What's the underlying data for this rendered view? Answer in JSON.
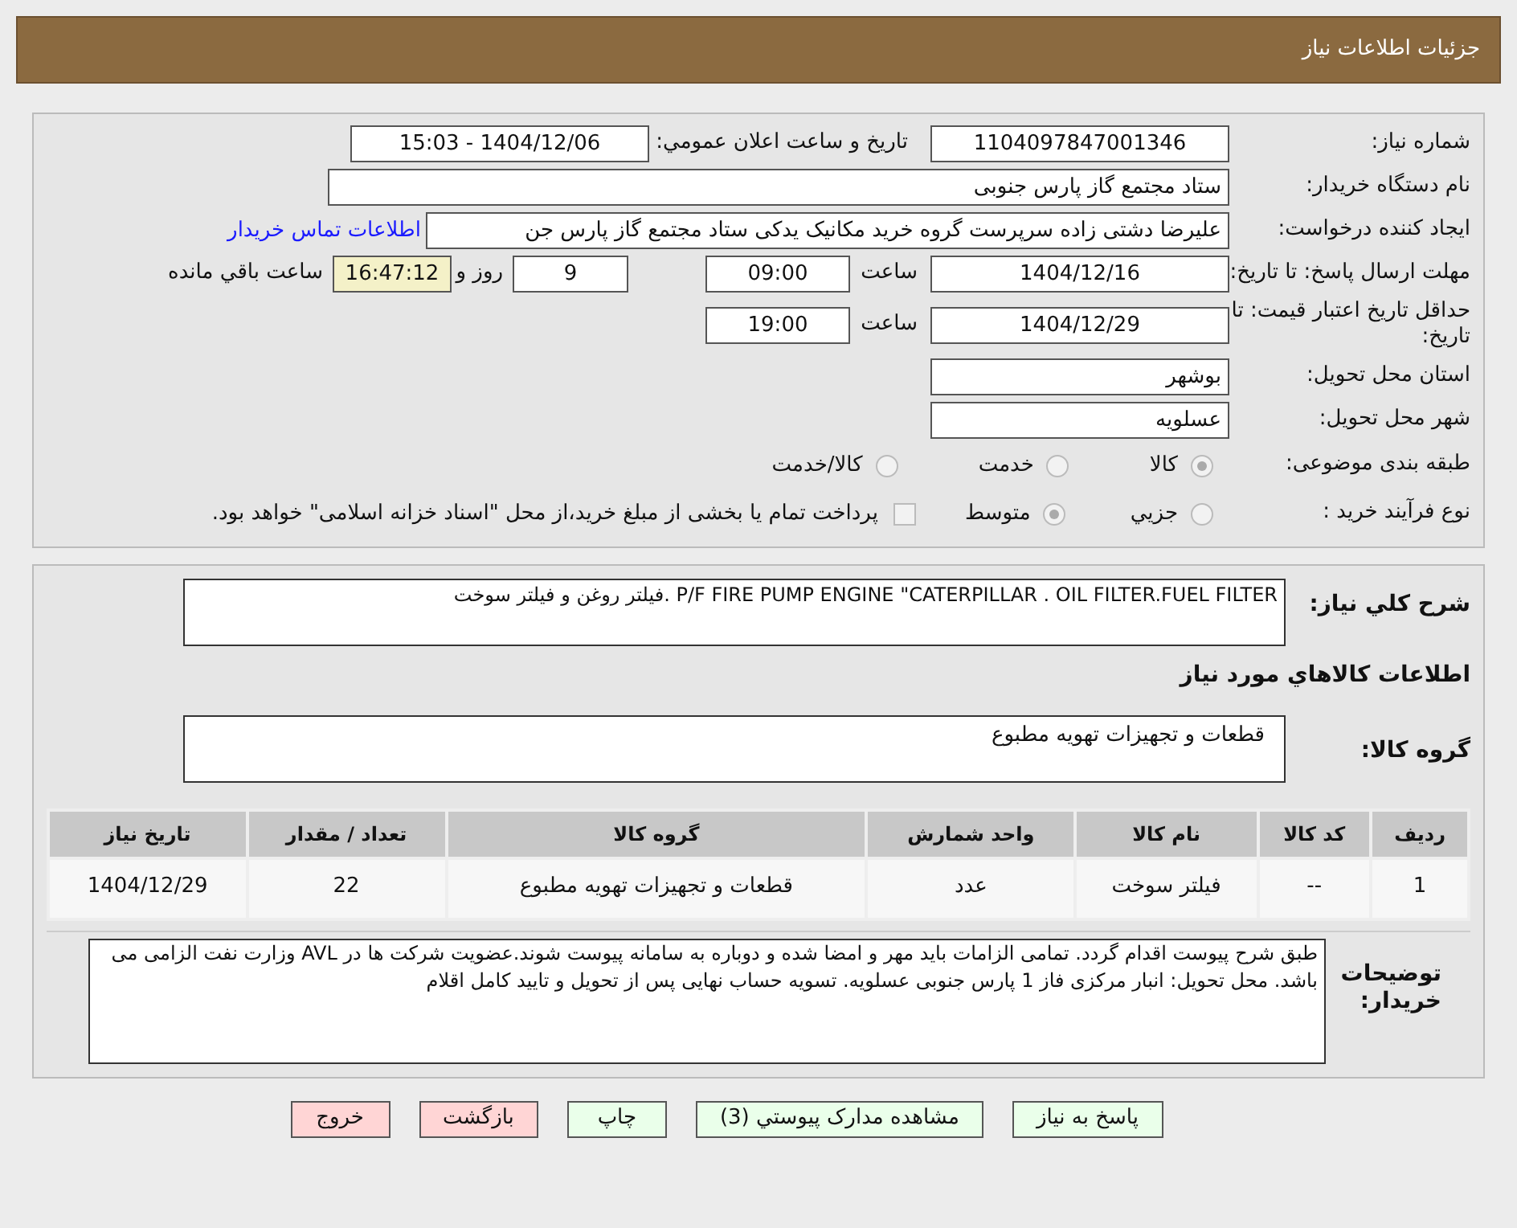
{
  "header": {
    "title": "جزئیات اطلاعات نیاز"
  },
  "need_number": {
    "label": "شماره نیاز:",
    "value": "1104097847001346"
  },
  "announce": {
    "label": "تاریخ و ساعت اعلان عمومي:",
    "value": "1404/12/06 - 15:03"
  },
  "buyer": {
    "label": "نام دستگاه خریدار:",
    "value": "ستاد مجتمع گاز پارس جنوبی"
  },
  "requester": {
    "label": "ایجاد کننده درخواست:",
    "value": "علیرضا دشتی زاده سرپرست گروه خرید مکانیک یدکی ستاد مجتمع گاز پارس جن",
    "link": "اطلاعات تماس خریدار"
  },
  "deadline": {
    "label": "مهلت ارسال پاسخ: تا تاریخ:",
    "date": "1404/12/16",
    "time_label": "ساعت",
    "time": "09:00",
    "days": "9",
    "days_label": "روز و",
    "remaining": "16:47:12",
    "remaining_label": "ساعت باقي مانده"
  },
  "validity": {
    "label": "حداقل تاریخ اعتبار قیمت: تا تاریخ:",
    "date": "1404/12/29",
    "time_label": "ساعت",
    "time": "19:00"
  },
  "province": {
    "label": "استان محل تحویل:",
    "value": "بوشهر"
  },
  "city": {
    "label": "شهر محل تحویل:",
    "value": "عسلویه"
  },
  "category": {
    "label": "طبقه بندی موضوعی:",
    "options": [
      {
        "label": "کالا",
        "selected": true
      },
      {
        "label": "خدمت",
        "selected": false
      },
      {
        "label": "کالا/خدمت",
        "selected": false
      }
    ]
  },
  "process": {
    "label": "نوع فرآیند خرید :",
    "options": [
      {
        "label": "جزيي",
        "selected": false
      },
      {
        "label": "متوسط",
        "selected": true
      }
    ],
    "payment": {
      "checked": false,
      "label": "پرداخت تمام یا بخشی از مبلغ خرید،از محل \"اسناد خزانه اسلامی\" خواهد بود."
    }
  },
  "description": {
    "label": "شرح کلي نیاز:",
    "value": "P/F FIRE PUMP ENGINE \"CATERPILLAR . OIL FILTER.FUEL FILTER .فیلتر روغن و فیلتر سوخت"
  },
  "goods": {
    "title": "اطلاعات کالاهاي مورد نیاز",
    "group_label": "گروه کالا:",
    "group_value": "قطعات و تجهیزات تهویه مطبوع"
  },
  "table": {
    "columns": [
      "ردیف",
      "کد کالا",
      "نام کالا",
      "واحد شمارش",
      "گروه کالا",
      "تعداد / مقدار",
      "تاریخ نیاز"
    ],
    "rows": [
      [
        "1",
        "--",
        "فیلتر سوخت",
        "عدد",
        "قطعات و تجهیزات تهویه مطبوع",
        "22",
        "1404/12/29"
      ]
    ]
  },
  "notes": {
    "label": "توضیحات خریدار:",
    "value": "طبق شرح پیوست اقدام گردد. تمامی الزامات باید مهر و امضا شده و دوباره به سامانه پیوست شوند.عضویت شرکت ها در AVL وزارت نفت الزامی می باشد. محل تحویل: انبار مرکزی فاز 1 پارس جنوبی عسلویه. تسویه حساب نهایی پس از تحویل و تایید کامل اقلام"
  },
  "buttons": [
    {
      "label": "پاسخ به نیاز",
      "color": "#eaffea"
    },
    {
      "label": "مشاهده مدارک پیوستي (3)",
      "color": "#eaffea"
    },
    {
      "label": "چاپ",
      "color": "#eaffea"
    },
    {
      "label": "بازگشت",
      "color": "#ffd5d5"
    },
    {
      "label": "خروج",
      "color": "#ffd5d5"
    }
  ]
}
